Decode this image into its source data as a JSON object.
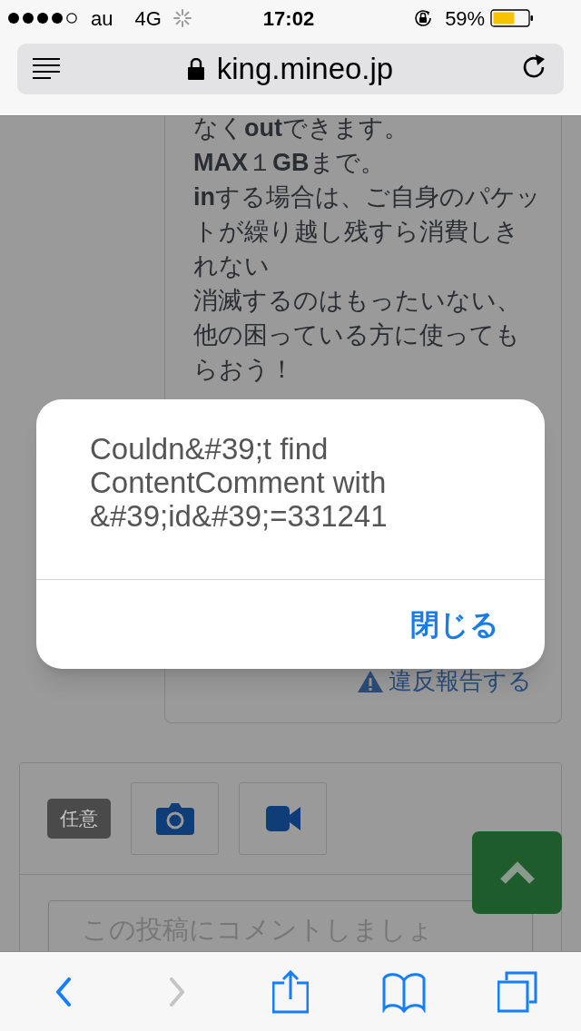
{
  "status_bar": {
    "carrier": "au",
    "network": "4G",
    "time": "17:02",
    "battery": "59%"
  },
  "address_bar": {
    "url": "king.mineo.jp"
  },
  "comment": {
    "lines": [
      "なく**out**できます。",
      "**MAX**１**GB**まで。",
      "**in**する場合は、ご自身のパケットが繰り越し残すら消費しきれない",
      "消滅するのはもったいない、他の困っている方に使ってもらおう！"
    ],
    "report_link": "違反報告する"
  },
  "comment_form": {
    "badge": "任意",
    "placeholder": "この投稿にコメントしましょ"
  },
  "alert": {
    "message": "Couldn&#39;t find ContentComment with &#39;id&#39;=331241",
    "button": "閉じる"
  },
  "toolbar": [
    {
      "kind": "back",
      "disabled": false
    },
    {
      "kind": "forward",
      "disabled": true
    },
    {
      "kind": "share",
      "disabled": false
    },
    {
      "kind": "bookmarks",
      "disabled": false
    },
    {
      "kind": "tabs",
      "disabled": false
    }
  ]
}
